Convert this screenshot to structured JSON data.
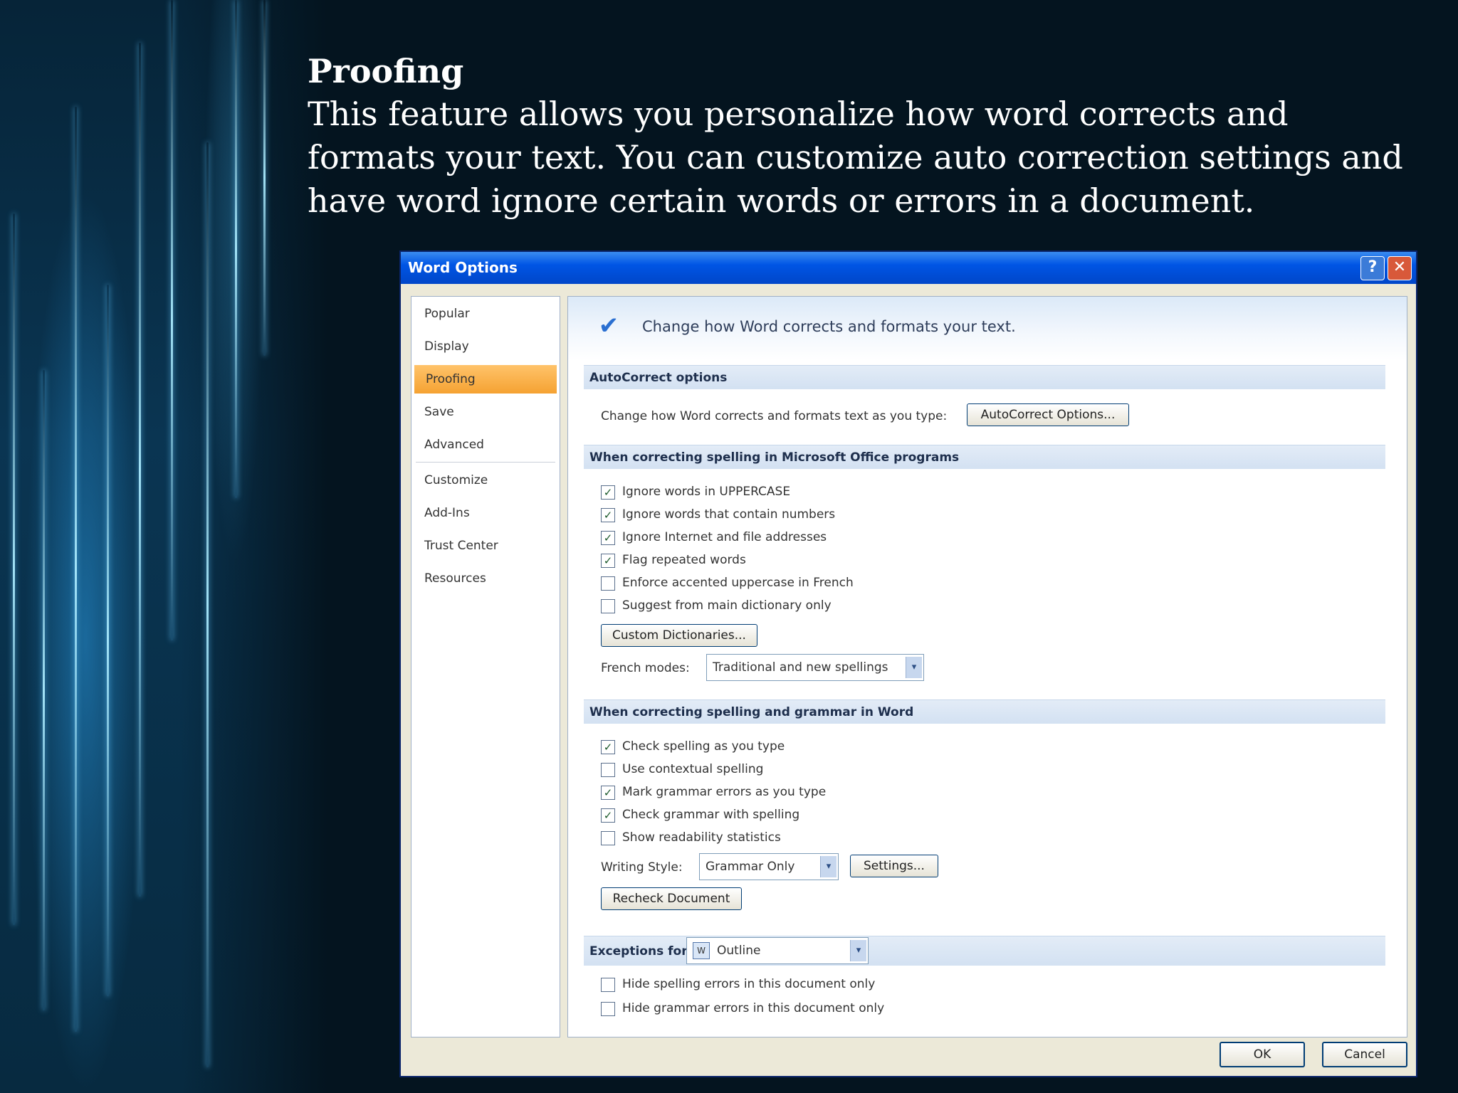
{
  "slide": {
    "heading": "Proofing",
    "paragraph": "This feature allows you personalize how word corrects and formats your text. You can customize auto correction settings and have word ignore certain words or errors in a document."
  },
  "dialog": {
    "title": "Word Options",
    "help_icon": "question-icon",
    "close_icon": "close-icon",
    "nav": {
      "items": [
        "Popular",
        "Display",
        "Proofing",
        "Save",
        "Advanced",
        "Customize",
        "Add-Ins",
        "Trust Center",
        "Resources"
      ],
      "active": "Proofing"
    },
    "banner_text": "Change how Word corrects and formats your text.",
    "autocorrect": {
      "header": "AutoCorrect options",
      "description": "Change how Word corrects and formats text as you type:",
      "button": "AutoCorrect Options..."
    },
    "office_spelling": {
      "header": "When correcting spelling in Microsoft Office programs",
      "options": [
        {
          "label": "Ignore words in UPPERCASE",
          "checked": true
        },
        {
          "label": "Ignore words that contain numbers",
          "checked": true
        },
        {
          "label": "Ignore Internet and file addresses",
          "checked": true
        },
        {
          "label": "Flag repeated words",
          "checked": true
        },
        {
          "label": "Enforce accented uppercase in French",
          "checked": false
        },
        {
          "label": "Suggest from main dictionary only",
          "checked": false
        }
      ],
      "custom_dict_button": "Custom Dictionaries...",
      "french_modes_label": "French modes:",
      "french_modes_value": "Traditional and new spellings"
    },
    "word_spelling": {
      "header": "When correcting spelling and grammar in Word",
      "options": [
        {
          "label": "Check spelling as you type",
          "checked": true
        },
        {
          "label": "Use contextual spelling",
          "checked": false
        },
        {
          "label": "Mark grammar errors as you type",
          "checked": true
        },
        {
          "label": "Check grammar with spelling",
          "checked": true
        },
        {
          "label": "Show readability statistics",
          "checked": false
        }
      ],
      "writing_style_label": "Writing Style:",
      "writing_style_value": "Grammar Only",
      "settings_button": "Settings...",
      "recheck_button": "Recheck Document"
    },
    "exceptions": {
      "label": "Exceptions for:",
      "document_value": "Outline",
      "options": [
        {
          "label": "Hide spelling errors in this document only",
          "checked": false
        },
        {
          "label": "Hide grammar errors in this document only",
          "checked": false
        }
      ]
    },
    "ok_button": "OK",
    "cancel_button": "Cancel",
    "check_mark": "✓",
    "dropdown_arrow": "▾"
  }
}
